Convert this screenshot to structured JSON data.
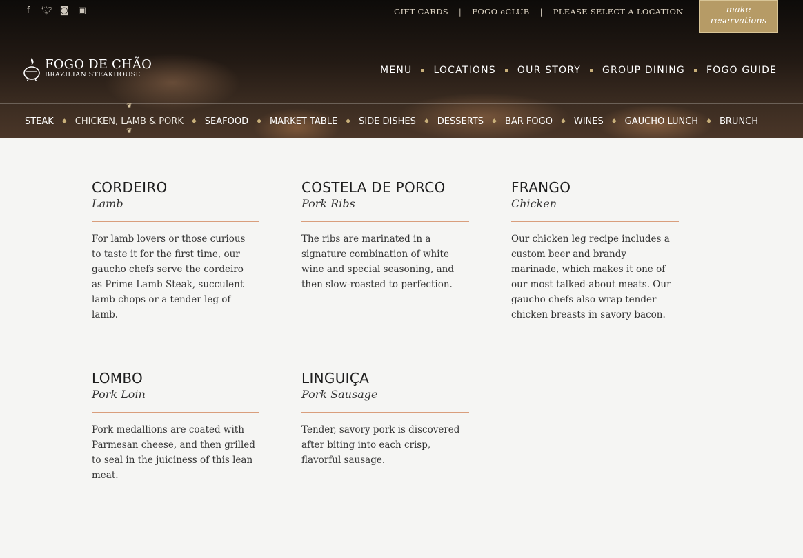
{
  "social": [
    "facebook-icon",
    "twitter-icon",
    "instagram-icon",
    "youtube-icon"
  ],
  "top_links": [
    "GIFT CARDS",
    "FOGO eCLUB",
    "PLEASE SELECT A LOCATION"
  ],
  "reservations": {
    "line1": "make",
    "line2": "reservations"
  },
  "logo": {
    "name": "FOGO DE CHÃO",
    "tagline": "BRAZILIAN STEAKHOUSE"
  },
  "main_nav": [
    "MENU",
    "LOCATIONS",
    "OUR STORY",
    "GROUP DINING",
    "FOGO GUIDE"
  ],
  "sub_nav": [
    "STEAK",
    "CHICKEN, LAMB & PORK",
    "SEAFOOD",
    "MARKET TABLE",
    "SIDE DISHES",
    "DESSERTS",
    "BAR FOGO",
    "WINES",
    "GAUCHO LUNCH",
    "BRUNCH"
  ],
  "sub_nav_active": "CHICKEN, LAMB & PORK",
  "items": [
    {
      "title": "CORDEIRO",
      "subtitle": "Lamb",
      "description": "For lamb lovers or those curious to taste it for the first time, our gaucho chefs serve the cordeiro as Prime Lamb Steak, succulent lamb chops or a tender leg of lamb."
    },
    {
      "title": "COSTELA DE PORCO",
      "subtitle": "Pork Ribs",
      "description": "The ribs are marinated in a signature combination of white wine and special seasoning, and then slow-roasted to perfection."
    },
    {
      "title": "FRANGO",
      "subtitle": "Chicken",
      "description": "Our chicken leg recipe includes a custom beer and brandy marinade, which makes it one of our most talked-about meats. Our gaucho chefs also wrap tender chicken breasts in savory bacon."
    },
    {
      "title": "LOMBO",
      "subtitle": "Pork Loin",
      "description": "Pork medallions are coated with Parmesan cheese, and then grilled to seal in the juiciness of this lean meat."
    },
    {
      "title": "LINGUIÇA",
      "subtitle": "Pork Sausage",
      "description": "Tender, savory pork is discovered after biting into each crisp, flavorful sausage."
    }
  ],
  "colors": {
    "accent_gold": "#b69b66",
    "rule_copper": "#d99e7c",
    "page_bg": "#f5f5f3"
  }
}
